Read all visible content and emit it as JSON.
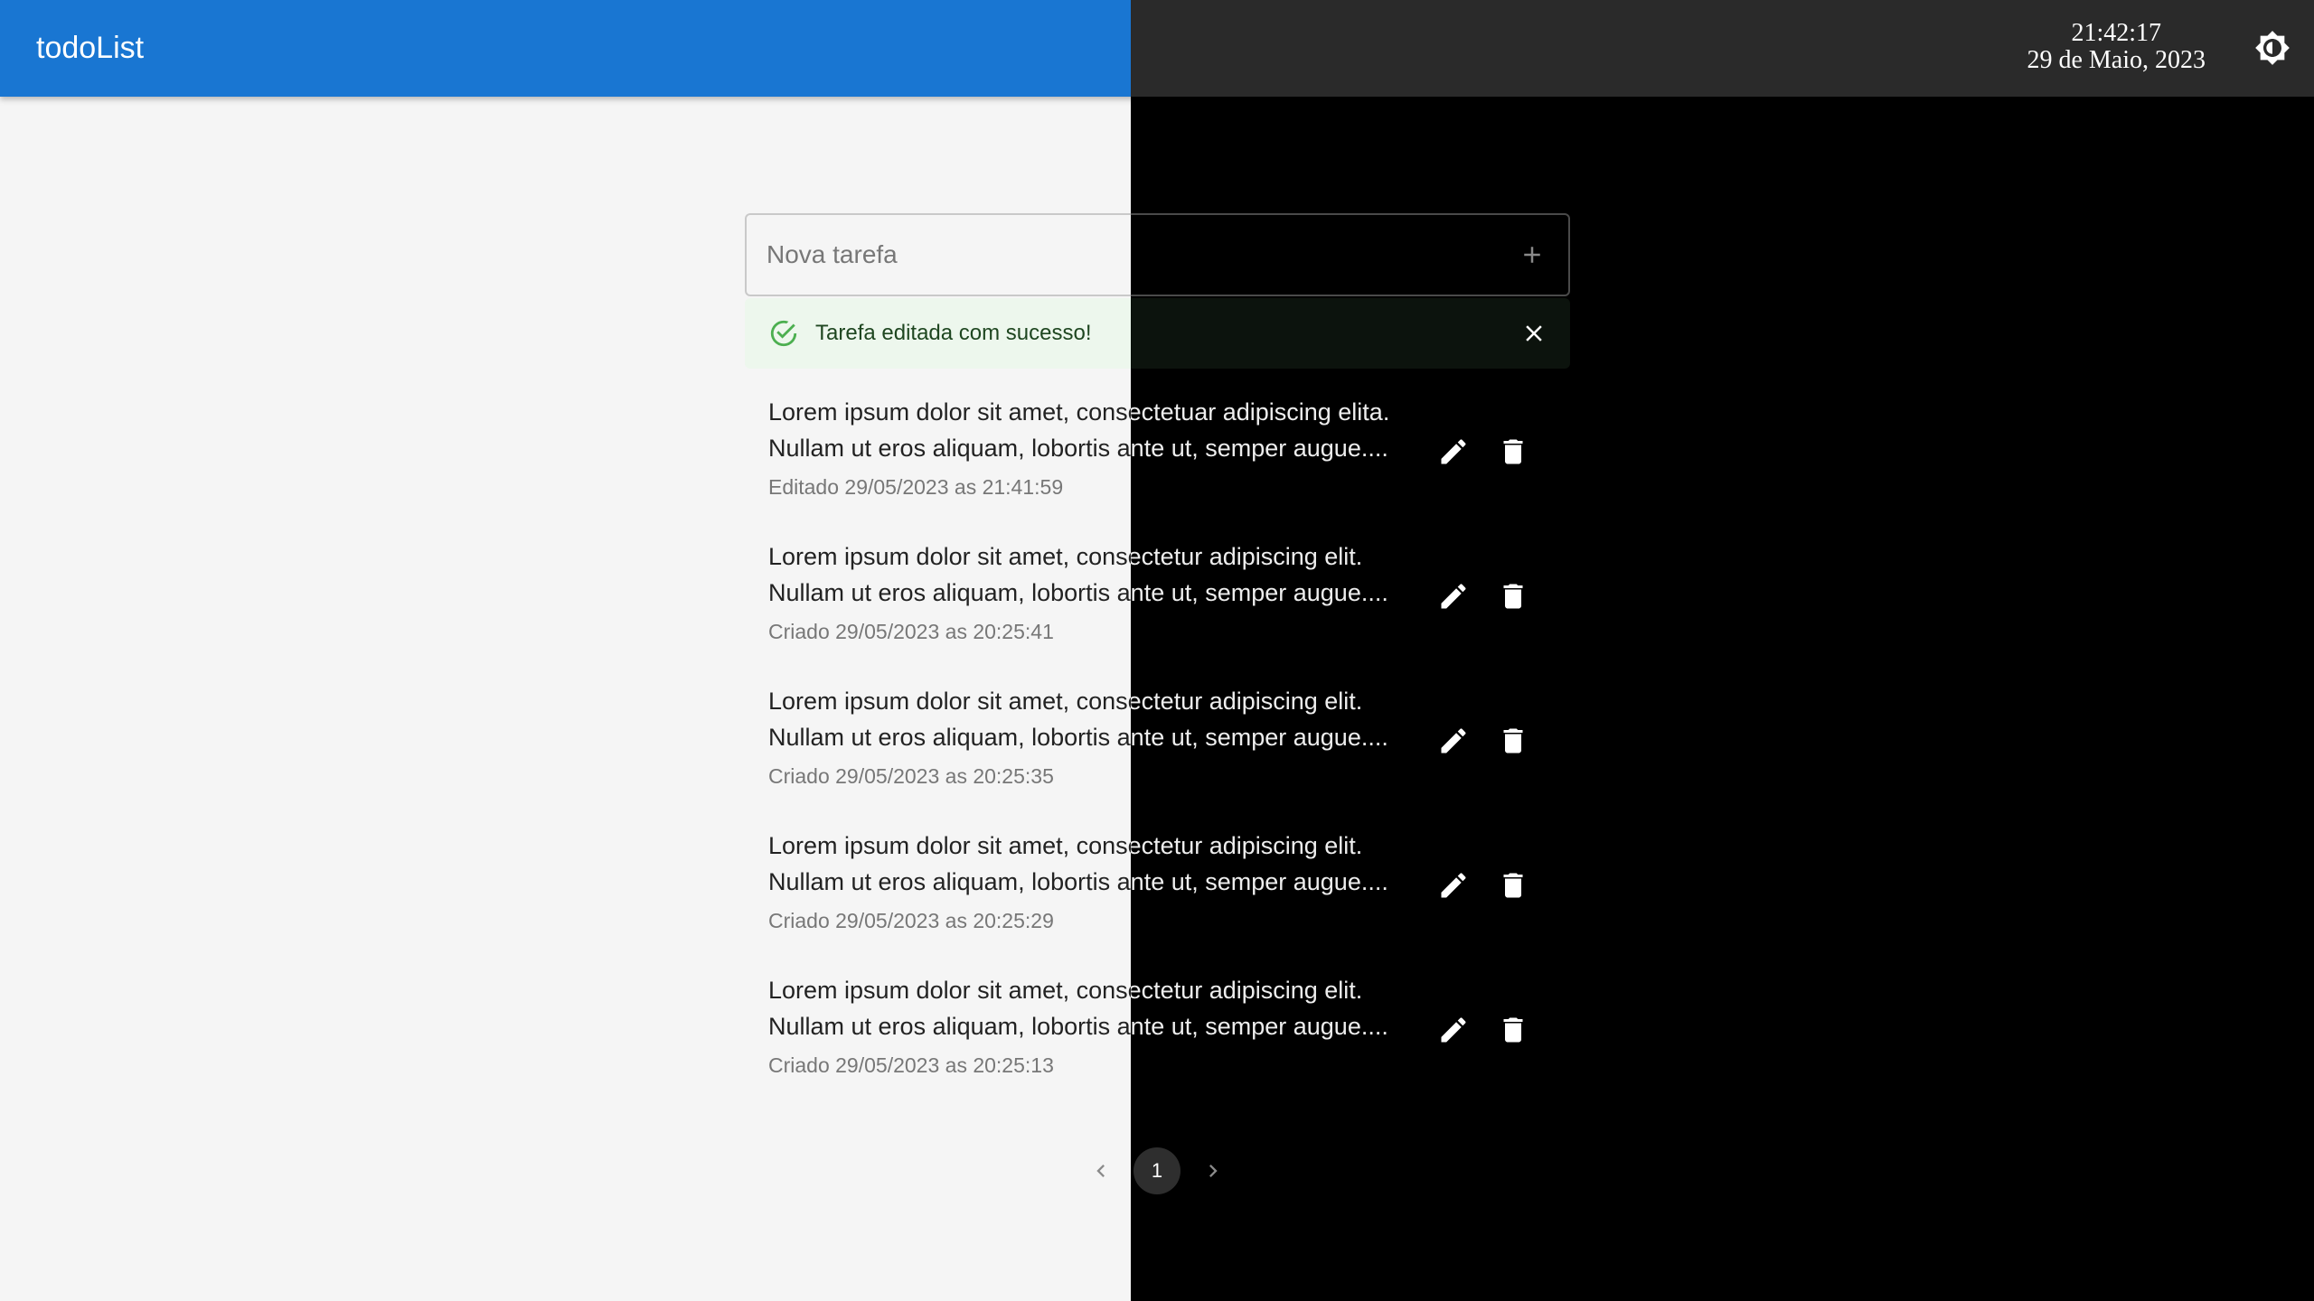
{
  "header": {
    "title": "todoList",
    "time": "21:42:17",
    "date": "29 de Maio, 2023",
    "theme_icon": "brightness-icon"
  },
  "new_task": {
    "placeholder": "Nova tarefa",
    "add_icon": "plus-icon"
  },
  "alert": {
    "message": "Tarefa editada com sucesso!",
    "icon": "check-circle-icon",
    "close_icon": "close-icon"
  },
  "tasks": [
    {
      "line1": "Lorem ipsum dolor sit amet, consectetuar adipiscing elita.",
      "line2": "Nullam ut eros aliquam, lobortis ante ut, semper augue....",
      "meta": "Editado 29/05/2023 as 21:41:59"
    },
    {
      "line1": "Lorem ipsum dolor sit amet, consectetur adipiscing elit.",
      "line2": "Nullam ut eros aliquam, lobortis ante ut, semper augue....",
      "meta": "Criado 29/05/2023 as 20:25:41"
    },
    {
      "line1": "Lorem ipsum dolor sit amet, consectetur adipiscing elit.",
      "line2": "Nullam ut eros aliquam, lobortis ante ut, semper augue....",
      "meta": "Criado 29/05/2023 as 20:25:35"
    },
    {
      "line1": "Lorem ipsum dolor sit amet, consectetur adipiscing elit.",
      "line2": "Nullam ut eros aliquam, lobortis ante ut, semper augue....",
      "meta": "Criado 29/05/2023 as 20:25:29"
    },
    {
      "line1": "Lorem ipsum dolor sit amet, consectetur adipiscing elit.",
      "line2": "Nullam ut eros aliquam, lobortis ante ut, semper augue....",
      "meta": "Criado 29/05/2023 as 20:25:13"
    }
  ],
  "task_actions": {
    "edit_icon": "pencil-icon",
    "delete_icon": "trash-icon"
  },
  "pagination": {
    "current_page": "1",
    "prev_icon": "chevron-left-icon",
    "next_icon": "chevron-right-icon"
  },
  "colors": {
    "light_background": "#f5f5f5",
    "dark_background": "#000000",
    "appbar_light": "#1976d2",
    "appbar_dark": "#2a2a2a",
    "success": "#4caf50"
  }
}
